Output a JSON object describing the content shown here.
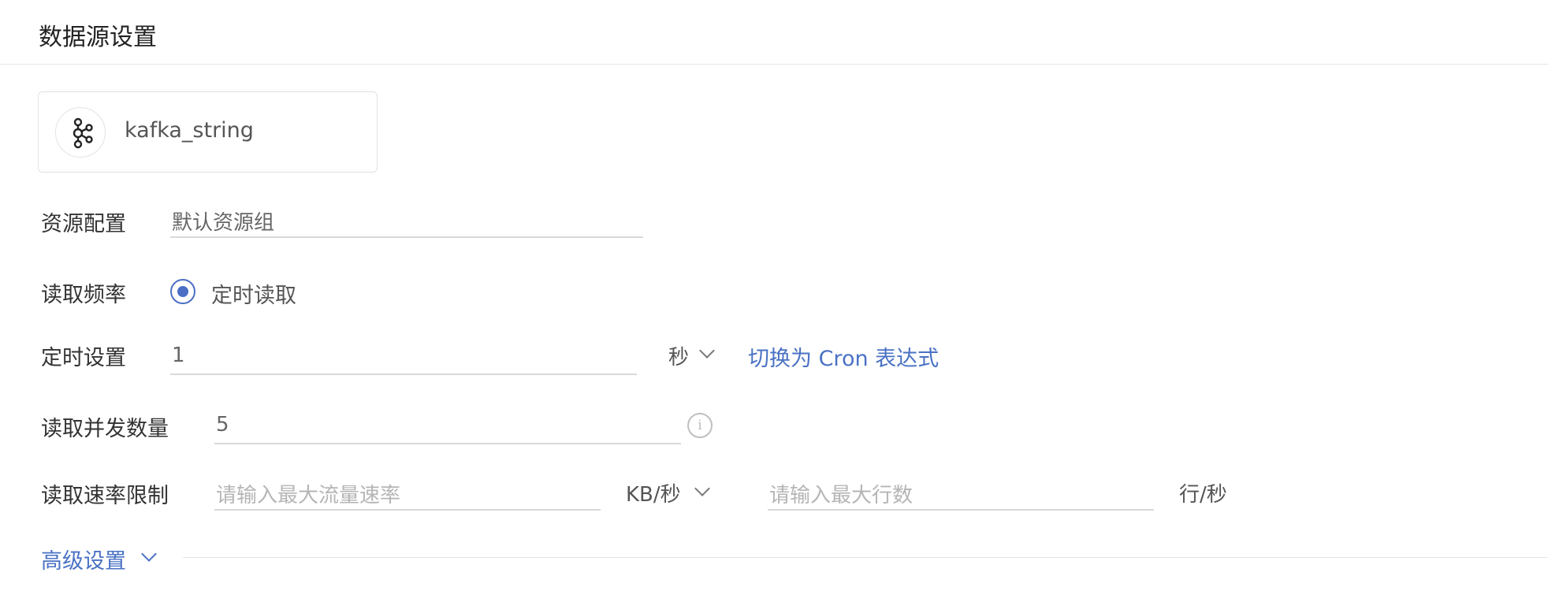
{
  "header": {
    "title": "数据源设置"
  },
  "source": {
    "name": "kafka_string",
    "icon": "kafka-icon"
  },
  "resource": {
    "label": "资源配置",
    "value": "默认资源组"
  },
  "frequency": {
    "label": "读取频率",
    "option": "定时读取",
    "selected": true
  },
  "schedule": {
    "label": "定时设置",
    "value": "1",
    "unit": "秒",
    "switch_link": "切换为 Cron 表达式"
  },
  "concurrency": {
    "label": "读取并发数量",
    "value": "5",
    "info_icon": "info-icon"
  },
  "rate_limit": {
    "label": "读取速率限制",
    "traffic_placeholder": "请输入最大流量速率",
    "traffic_unit": "KB/秒",
    "rows_placeholder": "请输入最大行数",
    "rows_unit": "行/秒"
  },
  "advanced": {
    "label": "高级设置"
  },
  "colors": {
    "accent": "#4a6fc4",
    "link": "#4a72c4",
    "border": "#d9d9d9"
  }
}
